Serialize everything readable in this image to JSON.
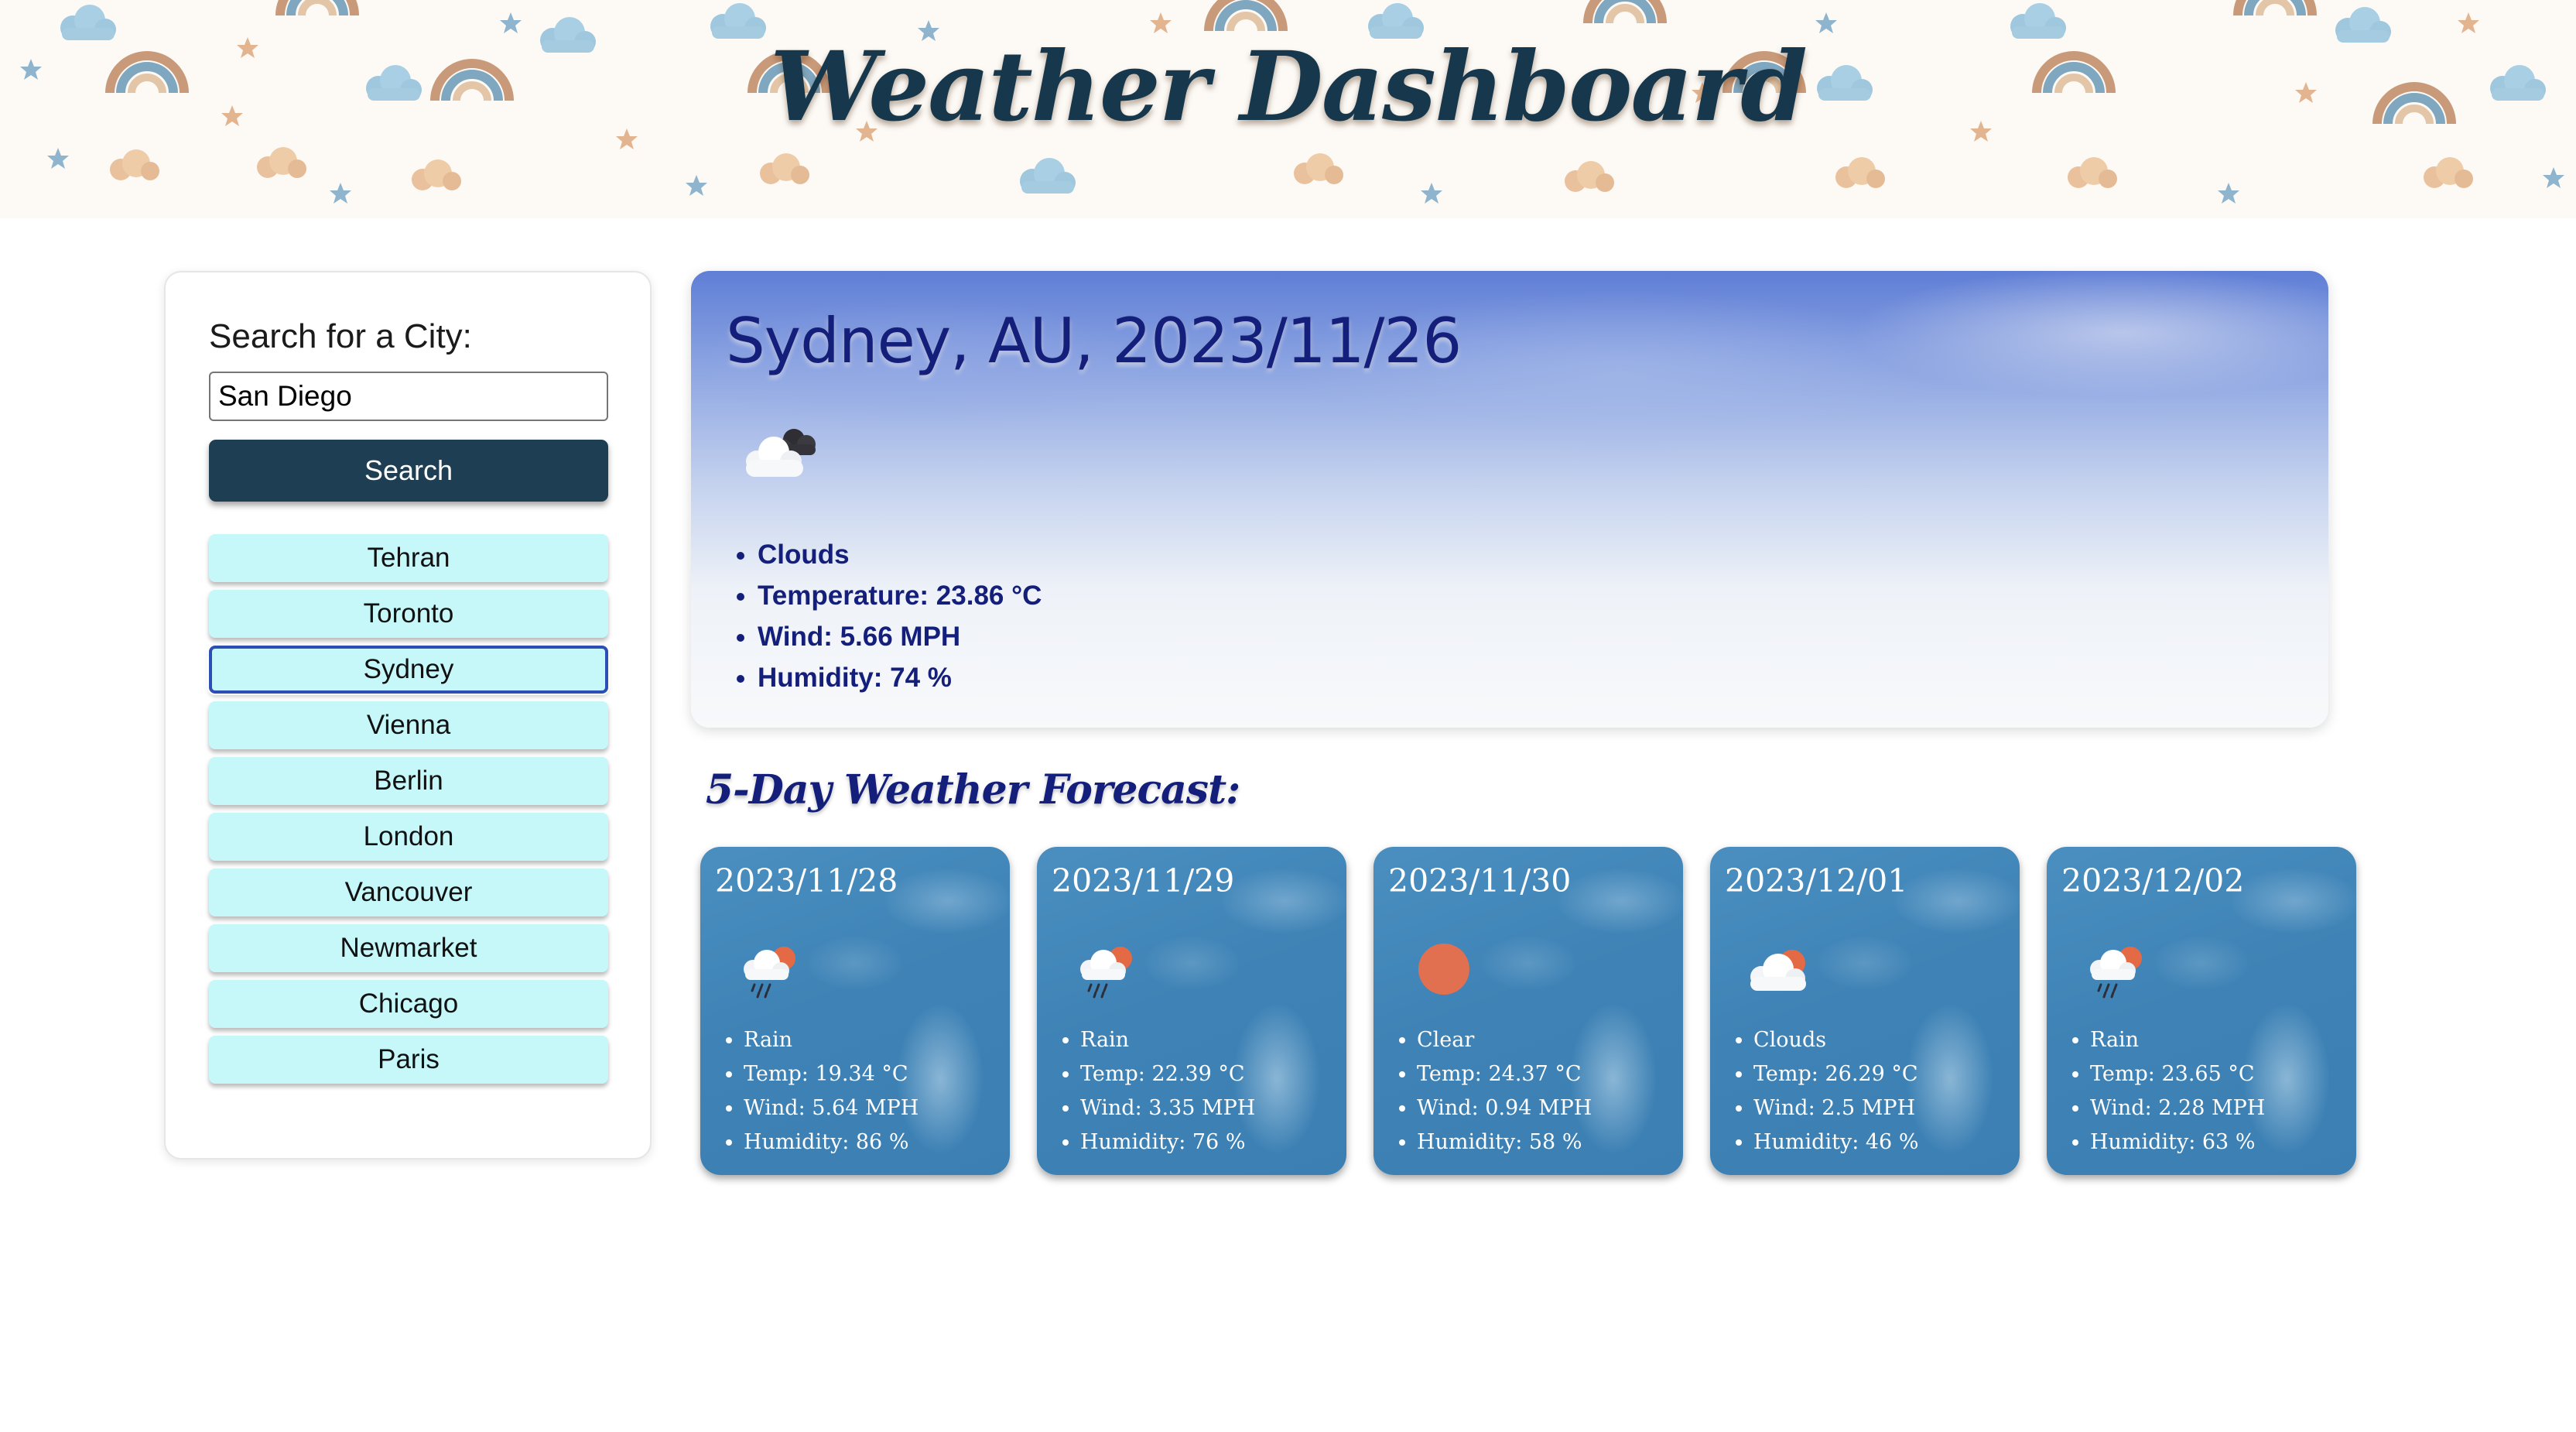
{
  "header": {
    "title": "Weather Dashboard"
  },
  "sidebar": {
    "search_label": "Search for a City:",
    "search_value": "San Diego",
    "search_button": "Search",
    "cities": [
      "Tehran",
      "Toronto",
      "Sydney",
      "Vienna",
      "Berlin",
      "London",
      "Vancouver",
      "Newmarket",
      "Chicago",
      "Paris"
    ],
    "active_city": "Sydney"
  },
  "current": {
    "title": "Sydney, AU, 2023/11/26",
    "icon": "broken-clouds-icon",
    "condition": "Clouds",
    "temperature": "Temperature: 23.86 °C",
    "wind": "Wind: 5.66 MPH",
    "humidity": "Humidity: 74 %"
  },
  "forecast": {
    "heading": "5-Day Weather Forecast:",
    "days": [
      {
        "date": "2023/11/28",
        "icon": "rain-icon",
        "condition": "Rain",
        "temp": "Temp: 19.34 °C",
        "wind": "Wind: 5.64 MPH",
        "humidity": "Humidity: 86 %"
      },
      {
        "date": "2023/11/29",
        "icon": "rain-icon",
        "condition": "Rain",
        "temp": "Temp: 22.39 °C",
        "wind": "Wind: 3.35 MPH",
        "humidity": "Humidity: 76 %"
      },
      {
        "date": "2023/11/30",
        "icon": "sun-icon",
        "condition": "Clear",
        "temp": "Temp: 24.37 °C",
        "wind": "Wind: 0.94 MPH",
        "humidity": "Humidity: 58 %"
      },
      {
        "date": "2023/12/01",
        "icon": "partly-cloudy-icon",
        "condition": "Clouds",
        "temp": "Temp: 26.29 °C",
        "wind": "Wind: 2.5 MPH",
        "humidity": "Humidity: 46 %"
      },
      {
        "date": "2023/12/02",
        "icon": "rain-icon",
        "condition": "Rain",
        "temp": "Temp: 23.65 °C",
        "wind": "Wind: 2.28 MPH",
        "humidity": "Humidity: 63 %"
      }
    ]
  },
  "colors": {
    "title": "#17384c",
    "search_button": "#1e3f53",
    "city_button": "#c6f8fa",
    "active_outline": "#2d4fb5",
    "current_text": "#131f7a",
    "forecast_card": "#3f83b6",
    "sun": "#e0704f"
  }
}
